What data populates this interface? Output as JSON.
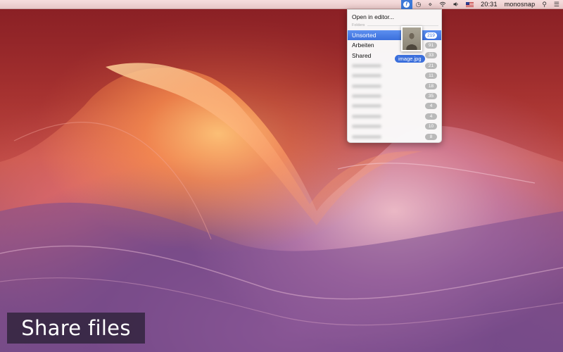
{
  "menubar": {
    "app_icon_glyph": "f",
    "icons": [
      "monosnap-icon",
      "time-machine-icon",
      "bluetooth-icon",
      "wifi-icon",
      "volume-icon",
      "us-flag-icon"
    ],
    "time": "20:31",
    "user": "monosnap",
    "search_glyph": "⚲",
    "list_glyph": "☰"
  },
  "dropdown": {
    "open_label": "Open in editor...",
    "section_label": "Folders",
    "folders": [
      {
        "label": "Unsorted",
        "count": "219",
        "selected": true
      },
      {
        "label": "Arbeiten",
        "count": "91"
      },
      {
        "label": "Shared",
        "count": "33"
      },
      {
        "label": "",
        "count": "21"
      },
      {
        "label": "",
        "count": "11"
      },
      {
        "label": "",
        "count": "18"
      },
      {
        "label": "",
        "count": "35"
      },
      {
        "label": "",
        "count": "4"
      },
      {
        "label": "",
        "count": "4"
      },
      {
        "label": "",
        "count": "10"
      },
      {
        "label": "",
        "count": "8"
      }
    ]
  },
  "drag": {
    "filename": "image.jpg"
  },
  "caption": {
    "text": "Share files"
  },
  "colors": {
    "accent": "#3b6fdc"
  }
}
